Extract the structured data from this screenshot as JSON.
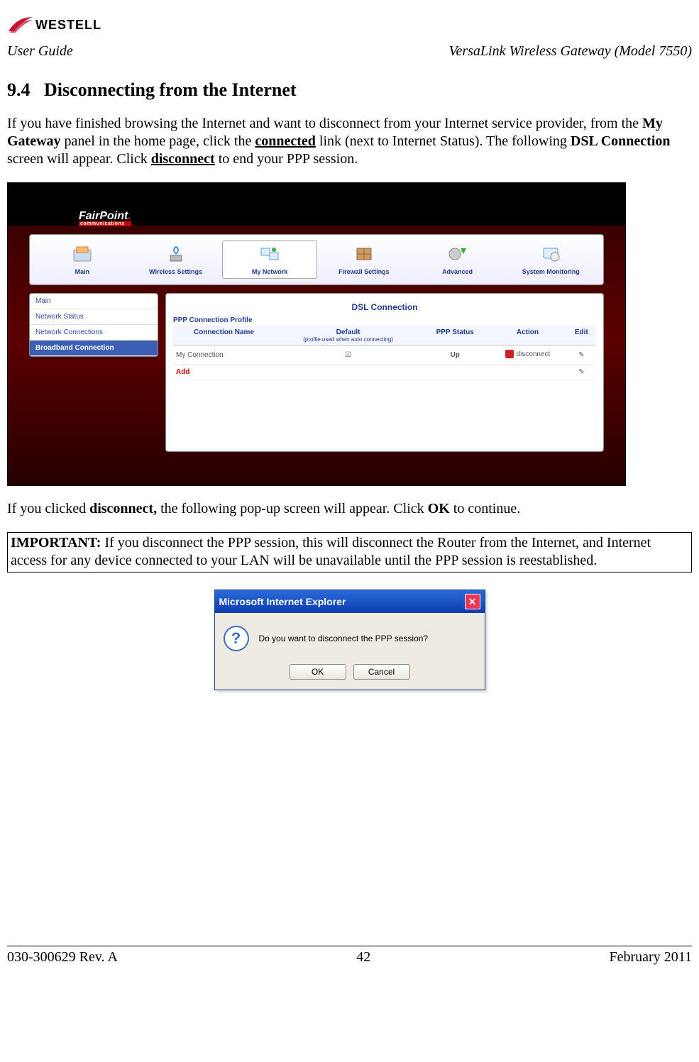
{
  "brand": "WESTELL",
  "header": {
    "left": "User Guide",
    "right": "VersaLink Wireless Gateway (Model 7550)"
  },
  "section_num": "9.4",
  "section_title": "Disconnecting from the Internet",
  "para1_a": "If you have finished browsing the Internet and want to disconnect from your Internet service provider, from the ",
  "para1_b": "My Gateway",
  "para1_c": " panel in the home page, click the ",
  "para1_d": "connected",
  "para1_e": " link (next to Internet Status). The following ",
  "para1_f": "DSL Connection",
  "para1_g": " screen will appear. Click ",
  "para1_h": "disconnect",
  "para1_i": " to end your PPP session.",
  "router": {
    "isp_logo": "FairPoint",
    "isp_sub": "communications",
    "nav": [
      "Main",
      "Wireless Settings",
      "My Network",
      "Firewall Settings",
      "Advanced",
      "System Monitoring"
    ],
    "nav_active_index": 2,
    "side": [
      "Main",
      "Network Status",
      "Network Connections",
      "Broadband Connection"
    ],
    "side_active_index": 3,
    "panel_title": "DSL Connection",
    "panel_sub": "PPP Connection Profile",
    "columns": {
      "c1": "Connection Name",
      "c2": "Default",
      "c2_sub": "(profile used when auto connecting)",
      "c3": "PPP Status",
      "c4": "Action",
      "c5": "Edit"
    },
    "row": {
      "name": "My Connection",
      "status": "Up",
      "action": "disconnect"
    },
    "add": "Add"
  },
  "para2_a": "If you clicked ",
  "para2_b": "disconnect,",
  "para2_c": " the following pop-up screen will appear. Click ",
  "para2_d": "OK",
  "para2_e": " to continue.",
  "important_label": "IMPORTANT:",
  "important_text": " If you disconnect the PPP session, this will disconnect the Router from the Internet, and Internet access for any device connected to your LAN will be unavailable until the PPP session is reestablished.",
  "dialog": {
    "title": "Microsoft Internet Explorer",
    "message": "Do you want to disconnect the PPP session?",
    "ok": "OK",
    "cancel": "Cancel"
  },
  "footer": {
    "left": "030-300629 Rev. A",
    "center": "42",
    "right": "February 2011"
  }
}
